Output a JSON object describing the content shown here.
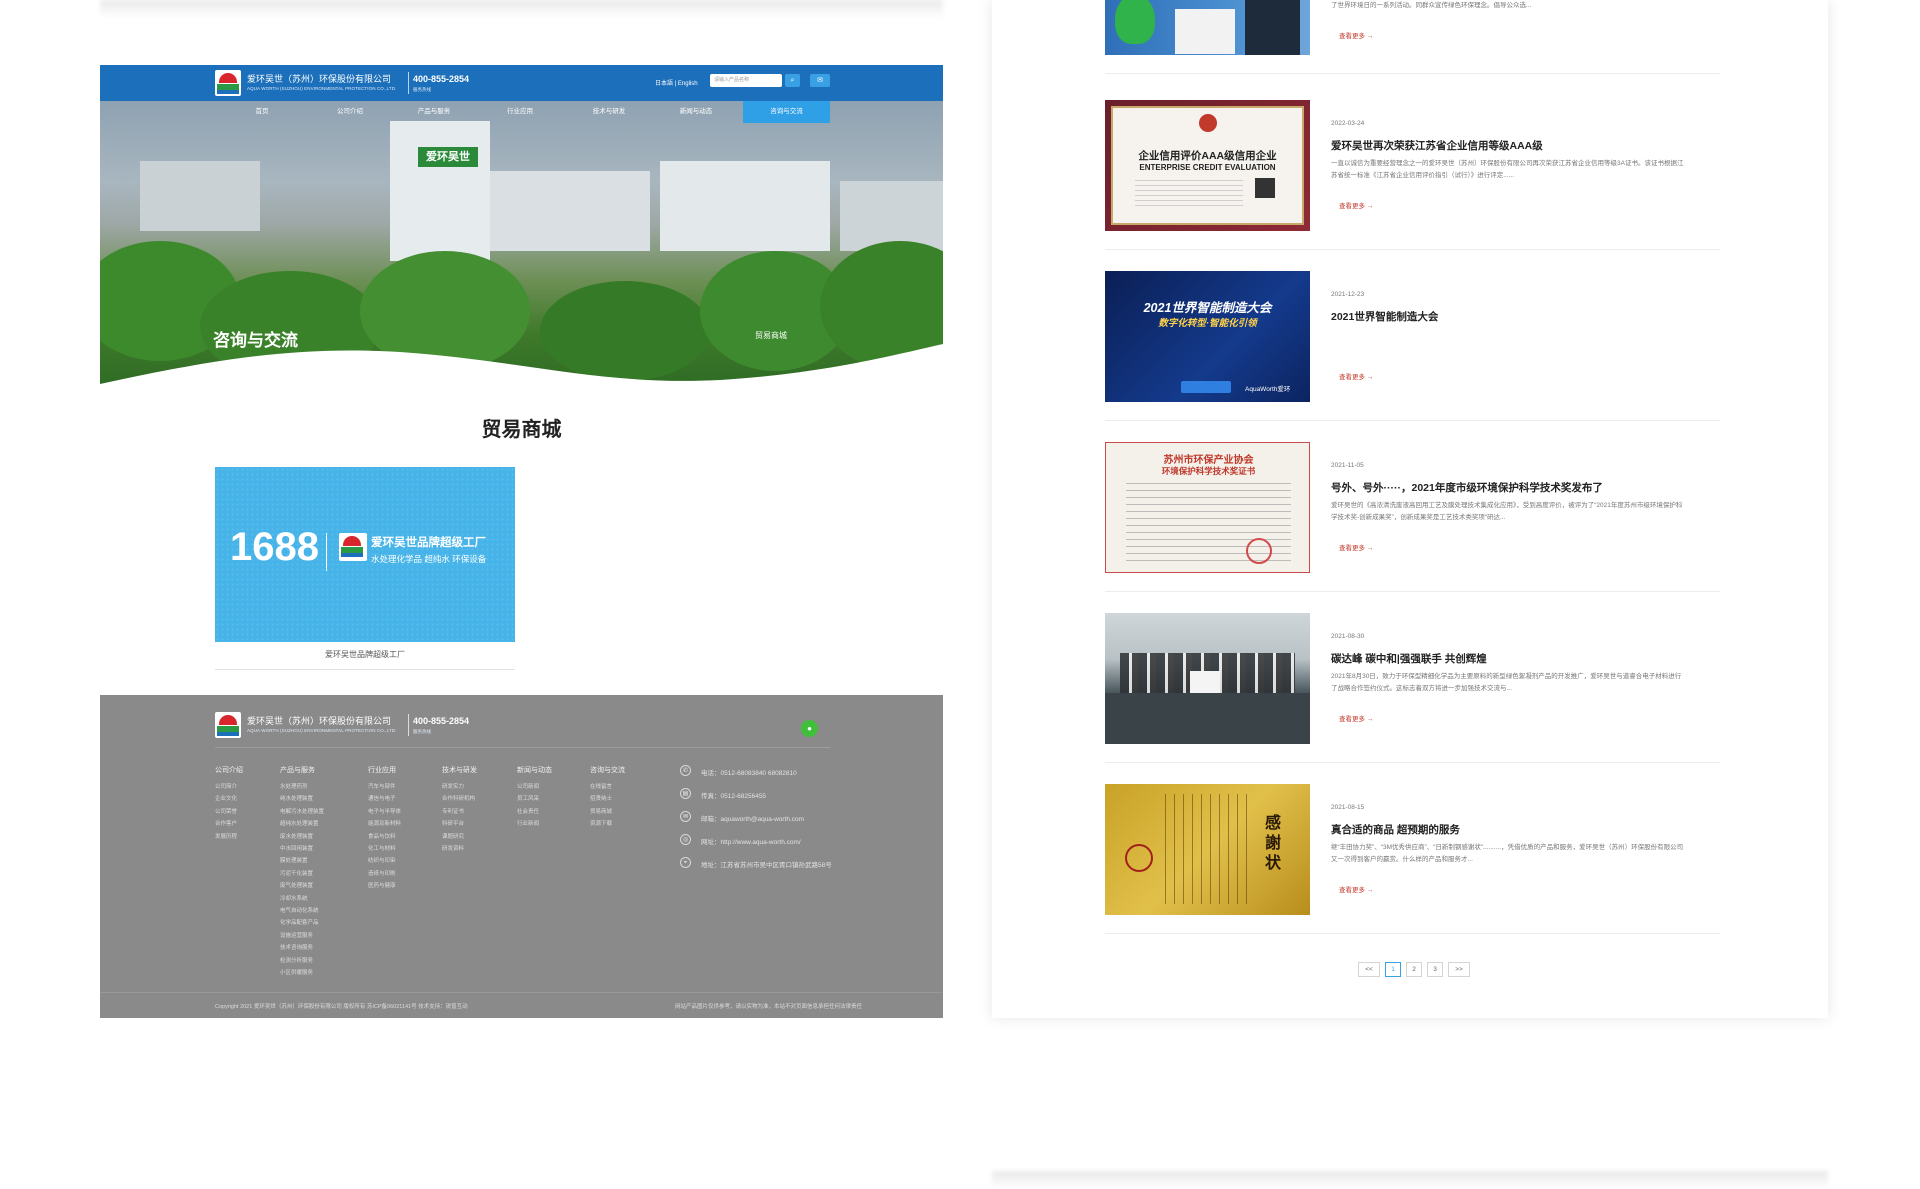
{
  "site": {
    "company_name": "爱环吴世（苏州）环保股份有限公司",
    "company_sub": "AQUA WORTH (SUZHOU) ENVIRONMENTAL PROTECTION CO.,LTD.",
    "phone": "400-855-2854",
    "phone_sub": "服务热线",
    "lang": "日本語 | English",
    "search_placeholder": "请输入产品名称",
    "search_icon": "search-icon",
    "mail_icon": "mail-icon",
    "building_sign": "爱环吴世"
  },
  "nav": [
    "首页",
    "公司介绍",
    "产品与服务",
    "行业应用",
    "技术与研发",
    "新闻与动态",
    "咨询与交流"
  ],
  "nav_active": "咨询与交流",
  "hero": {
    "title": "咨询与交流",
    "right_label": "贸易商城"
  },
  "section_title": "贸易商城",
  "promo": {
    "num": "1688",
    "line1": "爱环吴世品牌超级工厂",
    "line2": "水处理化学品 超纯水 环保设备",
    "caption": "爱环吴世品牌超级工厂"
  },
  "footer": {
    "columns": [
      {
        "title": "公司介绍",
        "items": [
          "公司简介",
          "企业文化",
          "公司荣誉",
          "合作客户",
          "发展历程"
        ]
      },
      {
        "title": "产品与服务",
        "items": [
          "水处理药剂",
          "纯水处理装置",
          "电解污水处理装置",
          "超纯水处理装置",
          "废水处理装置",
          "中水回用装置",
          "膜处理装置",
          "污泥干化装置",
          "废气处理装置",
          "冷却水系统",
          "电气自动化系统",
          "化学品配套产品",
          "设施运营服务",
          "技术咨询服务",
          "检测分析服务",
          "小区供暖服务"
        ]
      },
      {
        "title": "行业应用",
        "items": [
          "汽车与部件",
          "通信与电子",
          "电子与半导体",
          "能源及新材料",
          "食品与饮料",
          "化工与材料",
          "纺织与印染",
          "造纸与印刷",
          "医药与健康"
        ]
      },
      {
        "title": "技术与研发",
        "items": [
          "研发实力",
          "合作科研机构",
          "专利证书",
          "科研平台",
          "课题研究",
          "研发资料"
        ]
      },
      {
        "title": "新闻与动态",
        "items": [
          "公司新闻",
          "员工风采",
          "社会责任",
          "行业新闻"
        ]
      },
      {
        "title": "咨询与交流",
        "items": [
          "在线留言",
          "招贤纳士",
          "贸易商城",
          "资源下载"
        ]
      }
    ],
    "contacts": [
      {
        "icon": "phone-icon",
        "text": "电话：0512-68083840 68082810"
      },
      {
        "icon": "fax-icon",
        "text": "传真：0512-68256455"
      },
      {
        "icon": "email-icon",
        "text": "邮箱：aquaworth@aqua-worth.com"
      },
      {
        "icon": "globe-icon",
        "text": "网址：http://www.aqua-worth.com/"
      },
      {
        "icon": "location-icon",
        "text": "地址：江苏省苏州市吴中区胥口镇孙武路58号"
      }
    ],
    "copyright": "Copyright 2021 爱环吴世（苏州）环保股份有限公司 版权所有 苏ICP备06021141号 技术支持：锐普互动",
    "copyright_right": "网站产品图片仅供参考，请以实物为准，本站不对页面信息承担任何法律责任"
  },
  "news": [
    {
      "date": "",
      "title": "",
      "desc": "了世界环境日的一系列活动。同群众宣传绿色环保理念。倡导公众选...",
      "more": "查看更多 →"
    },
    {
      "date": "2022-03-24",
      "title": "爱环吴世再次荣获江苏省企业信用等级AAA级",
      "desc": "一直以诚信为重要经营理念之一的爱环吴世（苏州）环保股份有限公司再次荣获江苏省企业信用等级3A证书。该证书根据江苏省统一标准《江苏省企业信用评价指引（试行）》进行评定......",
      "more": "查看更多 →"
    },
    {
      "date": "2021-12-23",
      "title": "2021世界智能制造大会",
      "desc": "",
      "more": "查看更多 →"
    },
    {
      "date": "2021-11-05",
      "title": "号外、号外·····，2021年度市级环境保护科学技术奖发布了",
      "desc": "爱环吴世的《高浓清洗废液高回用工艺及膜处理技术集成化应用》，受到高度评价，被评为了“2021年度苏州市级环境保护科学技术奖-创新成果奖”，创新成果奖是工艺技术类奖项“研达...",
      "more": "查看更多 →"
    },
    {
      "date": "2021-08-30",
      "title": "碳达峰 碳中和|强强联手 共创辉煌",
      "desc": "2021年8月30日，致力于环保型精细化学品为主要原料的新型绿色絮凝剂产品的开发推广，爱环吴世与道睿合电子材料进行了战略合作签约仪式。这标志着双方将进一步加强技术交流与...",
      "more": "查看更多 →"
    },
    {
      "date": "2021-08-15",
      "title": "真合适的商品 超预期的服务",
      "desc": "继“丰田协力奖”、“3M优秀供应商”、“日新制钢感谢状”..........，凭借优质的产品和服务，爱环吴世（苏州）环保股份有限公司又一次得到客户的赢赏。什么样的产品和服务才...",
      "more": "查看更多 →"
    }
  ],
  "thumbs": {
    "t2_line1": "企业信用评价AAA级信用企业",
    "t2_line2": "ENTERPRISE CREDIT EVALUATION",
    "t3_line1": "2021世界智能制造大会",
    "t3_line2": "数字化转型·智能化引领",
    "t3_watermark": "AquaWorth爱环",
    "t4_line1": "苏州市环保产业协会",
    "t4_line2": "环境保护科学技术奖证书",
    "t6_text": "感謝状"
  },
  "pager": [
    "<<",
    "1",
    "2",
    "3",
    ">>"
  ],
  "pager_current": "1"
}
